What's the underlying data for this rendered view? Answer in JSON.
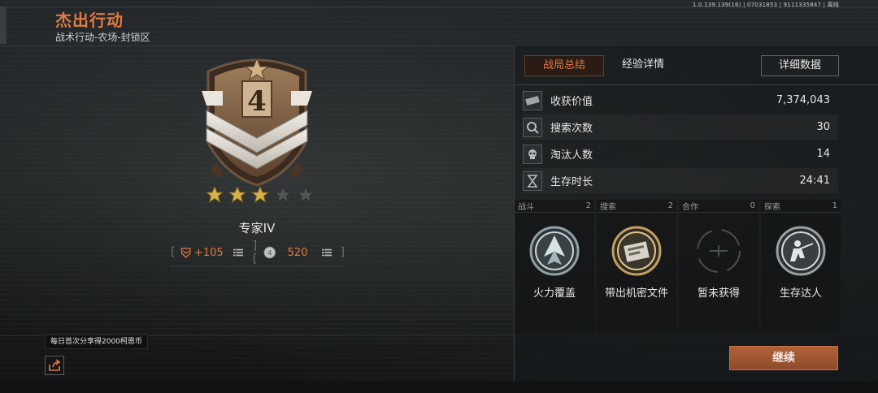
{
  "version_text": "1.0.139.139(16) | 07031853 | 9111335847 | 离线",
  "header": {
    "title": "杰出行动",
    "subtitle": "战术行动-农场-封锁区"
  },
  "rank": {
    "badge_number": "4",
    "stars_filled": 3,
    "stars_total": 5,
    "name": "专家IV",
    "reward_points": "+105",
    "reward_coins": "520"
  },
  "tooltip": "每日首次分享得2000柯恩币",
  "tabs": [
    {
      "label": "战局总结",
      "active": true
    },
    {
      "label": "经验详情",
      "active": false
    }
  ],
  "details_button": "详细数据",
  "stats": [
    {
      "icon": "cash-icon",
      "label": "收获价值",
      "value": "7,374,043"
    },
    {
      "icon": "search-icon",
      "label": "搜索次数",
      "value": "30"
    },
    {
      "icon": "skull-icon",
      "label": "淘汰人数",
      "value": "14"
    },
    {
      "icon": "hourglass-icon",
      "label": "生存时长",
      "value": "24:41"
    }
  ],
  "medals": [
    {
      "category": "战斗",
      "count": "2",
      "name": "火力覆盖",
      "icon": "firepower-medal-icon"
    },
    {
      "category": "搜索",
      "count": "2",
      "name": "带出机密文件",
      "icon": "document-medal-icon"
    },
    {
      "category": "合作",
      "count": "0",
      "name": "暂未获得",
      "icon": "empty-medal-icon"
    },
    {
      "category": "探索",
      "count": "1",
      "name": "生存达人",
      "icon": "soldier-medal-icon"
    }
  ],
  "continue_button": "继续",
  "colors": {
    "accent": "#e07a3f",
    "button": "#a65a35"
  }
}
